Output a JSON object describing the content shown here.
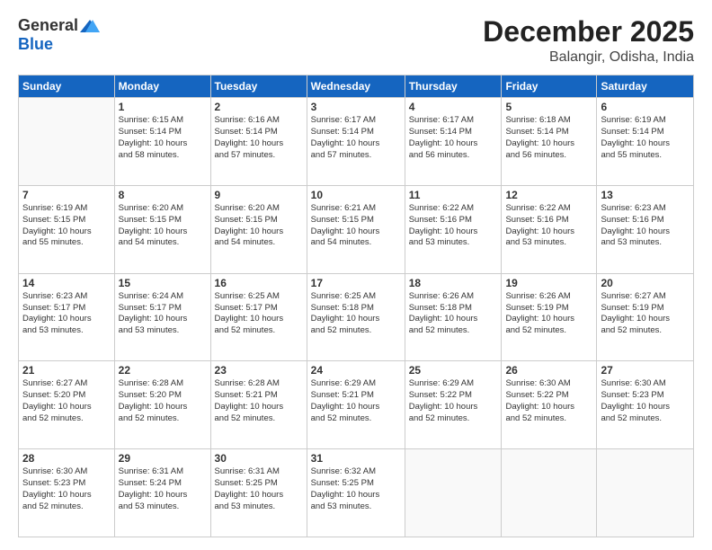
{
  "header": {
    "logo_general": "General",
    "logo_blue": "Blue",
    "month": "December 2025",
    "location": "Balangir, Odisha, India"
  },
  "days_of_week": [
    "Sunday",
    "Monday",
    "Tuesday",
    "Wednesday",
    "Thursday",
    "Friday",
    "Saturday"
  ],
  "weeks": [
    [
      {
        "day": "",
        "info": ""
      },
      {
        "day": "1",
        "info": "Sunrise: 6:15 AM\nSunset: 5:14 PM\nDaylight: 10 hours\nand 58 minutes."
      },
      {
        "day": "2",
        "info": "Sunrise: 6:16 AM\nSunset: 5:14 PM\nDaylight: 10 hours\nand 57 minutes."
      },
      {
        "day": "3",
        "info": "Sunrise: 6:17 AM\nSunset: 5:14 PM\nDaylight: 10 hours\nand 57 minutes."
      },
      {
        "day": "4",
        "info": "Sunrise: 6:17 AM\nSunset: 5:14 PM\nDaylight: 10 hours\nand 56 minutes."
      },
      {
        "day": "5",
        "info": "Sunrise: 6:18 AM\nSunset: 5:14 PM\nDaylight: 10 hours\nand 56 minutes."
      },
      {
        "day": "6",
        "info": "Sunrise: 6:19 AM\nSunset: 5:14 PM\nDaylight: 10 hours\nand 55 minutes."
      }
    ],
    [
      {
        "day": "7",
        "info": "Sunrise: 6:19 AM\nSunset: 5:15 PM\nDaylight: 10 hours\nand 55 minutes."
      },
      {
        "day": "8",
        "info": "Sunrise: 6:20 AM\nSunset: 5:15 PM\nDaylight: 10 hours\nand 54 minutes."
      },
      {
        "day": "9",
        "info": "Sunrise: 6:20 AM\nSunset: 5:15 PM\nDaylight: 10 hours\nand 54 minutes."
      },
      {
        "day": "10",
        "info": "Sunrise: 6:21 AM\nSunset: 5:15 PM\nDaylight: 10 hours\nand 54 minutes."
      },
      {
        "day": "11",
        "info": "Sunrise: 6:22 AM\nSunset: 5:16 PM\nDaylight: 10 hours\nand 53 minutes."
      },
      {
        "day": "12",
        "info": "Sunrise: 6:22 AM\nSunset: 5:16 PM\nDaylight: 10 hours\nand 53 minutes."
      },
      {
        "day": "13",
        "info": "Sunrise: 6:23 AM\nSunset: 5:16 PM\nDaylight: 10 hours\nand 53 minutes."
      }
    ],
    [
      {
        "day": "14",
        "info": "Sunrise: 6:23 AM\nSunset: 5:17 PM\nDaylight: 10 hours\nand 53 minutes."
      },
      {
        "day": "15",
        "info": "Sunrise: 6:24 AM\nSunset: 5:17 PM\nDaylight: 10 hours\nand 53 minutes."
      },
      {
        "day": "16",
        "info": "Sunrise: 6:25 AM\nSunset: 5:17 PM\nDaylight: 10 hours\nand 52 minutes."
      },
      {
        "day": "17",
        "info": "Sunrise: 6:25 AM\nSunset: 5:18 PM\nDaylight: 10 hours\nand 52 minutes."
      },
      {
        "day": "18",
        "info": "Sunrise: 6:26 AM\nSunset: 5:18 PM\nDaylight: 10 hours\nand 52 minutes."
      },
      {
        "day": "19",
        "info": "Sunrise: 6:26 AM\nSunset: 5:19 PM\nDaylight: 10 hours\nand 52 minutes."
      },
      {
        "day": "20",
        "info": "Sunrise: 6:27 AM\nSunset: 5:19 PM\nDaylight: 10 hours\nand 52 minutes."
      }
    ],
    [
      {
        "day": "21",
        "info": "Sunrise: 6:27 AM\nSunset: 5:20 PM\nDaylight: 10 hours\nand 52 minutes."
      },
      {
        "day": "22",
        "info": "Sunrise: 6:28 AM\nSunset: 5:20 PM\nDaylight: 10 hours\nand 52 minutes."
      },
      {
        "day": "23",
        "info": "Sunrise: 6:28 AM\nSunset: 5:21 PM\nDaylight: 10 hours\nand 52 minutes."
      },
      {
        "day": "24",
        "info": "Sunrise: 6:29 AM\nSunset: 5:21 PM\nDaylight: 10 hours\nand 52 minutes."
      },
      {
        "day": "25",
        "info": "Sunrise: 6:29 AM\nSunset: 5:22 PM\nDaylight: 10 hours\nand 52 minutes."
      },
      {
        "day": "26",
        "info": "Sunrise: 6:30 AM\nSunset: 5:22 PM\nDaylight: 10 hours\nand 52 minutes."
      },
      {
        "day": "27",
        "info": "Sunrise: 6:30 AM\nSunset: 5:23 PM\nDaylight: 10 hours\nand 52 minutes."
      }
    ],
    [
      {
        "day": "28",
        "info": "Sunrise: 6:30 AM\nSunset: 5:23 PM\nDaylight: 10 hours\nand 52 minutes."
      },
      {
        "day": "29",
        "info": "Sunrise: 6:31 AM\nSunset: 5:24 PM\nDaylight: 10 hours\nand 53 minutes."
      },
      {
        "day": "30",
        "info": "Sunrise: 6:31 AM\nSunset: 5:25 PM\nDaylight: 10 hours\nand 53 minutes."
      },
      {
        "day": "31",
        "info": "Sunrise: 6:32 AM\nSunset: 5:25 PM\nDaylight: 10 hours\nand 53 minutes."
      },
      {
        "day": "",
        "info": ""
      },
      {
        "day": "",
        "info": ""
      },
      {
        "day": "",
        "info": ""
      }
    ]
  ]
}
